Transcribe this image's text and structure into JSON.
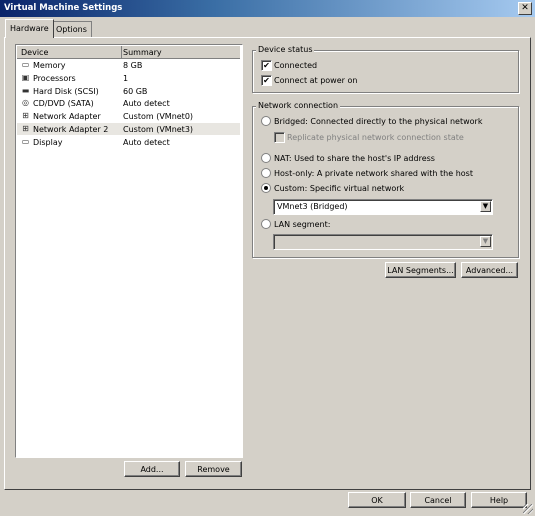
{
  "window": {
    "title": "Virtual Machine Settings",
    "close_glyph": "✕"
  },
  "tabs": [
    {
      "label": "Hardware"
    },
    {
      "label": "Options"
    }
  ],
  "device_list": {
    "headers": {
      "device": "Device",
      "summary": "Summary"
    },
    "rows": [
      {
        "device": "Memory",
        "summary": "8 GB",
        "icon": "memory-icon",
        "glyph": "▭"
      },
      {
        "device": "Processors",
        "summary": "1",
        "icon": "cpu-icon",
        "glyph": "▣"
      },
      {
        "device": "Hard Disk (SCSI)",
        "summary": "60 GB",
        "icon": "hard-disk-icon",
        "glyph": "▬"
      },
      {
        "device": "CD/DVD (SATA)",
        "summary": "Auto detect",
        "icon": "cd-icon",
        "glyph": "◎"
      },
      {
        "device": "Network Adapter",
        "summary": "Custom (VMnet0)",
        "icon": "network-icon",
        "glyph": "⊞"
      },
      {
        "device": "Network Adapter 2",
        "summary": "Custom (VMnet3)",
        "icon": "network-icon",
        "glyph": "⊞"
      },
      {
        "device": "Display",
        "summary": "Auto detect",
        "icon": "display-icon",
        "glyph": "▭"
      }
    ],
    "selected_index": 5
  },
  "list_buttons": {
    "add": "Add...",
    "remove": "Remove"
  },
  "device_status": {
    "title": "Device status",
    "connected": {
      "label": "Connected",
      "checked": true
    },
    "connect_power_on": {
      "label": "Connect at power on",
      "checked": true
    }
  },
  "network_connection": {
    "title": "Network connection",
    "bridged": "Bridged: Connected directly to the physical network",
    "replicate": "Replicate physical network connection state",
    "nat": "NAT: Used to share the host's IP address",
    "host_only": "Host-only: A private network shared with the host",
    "custom": "Custom: Specific virtual network",
    "custom_value": "VMnet3 (Bridged)",
    "lan_segment": "LAN segment:",
    "lan_segment_value": "",
    "selected": "custom"
  },
  "net_buttons": {
    "lan_segments": "LAN Segments...",
    "advanced": "Advanced..."
  },
  "footer": {
    "ok": "OK",
    "cancel": "Cancel",
    "help": "Help"
  }
}
